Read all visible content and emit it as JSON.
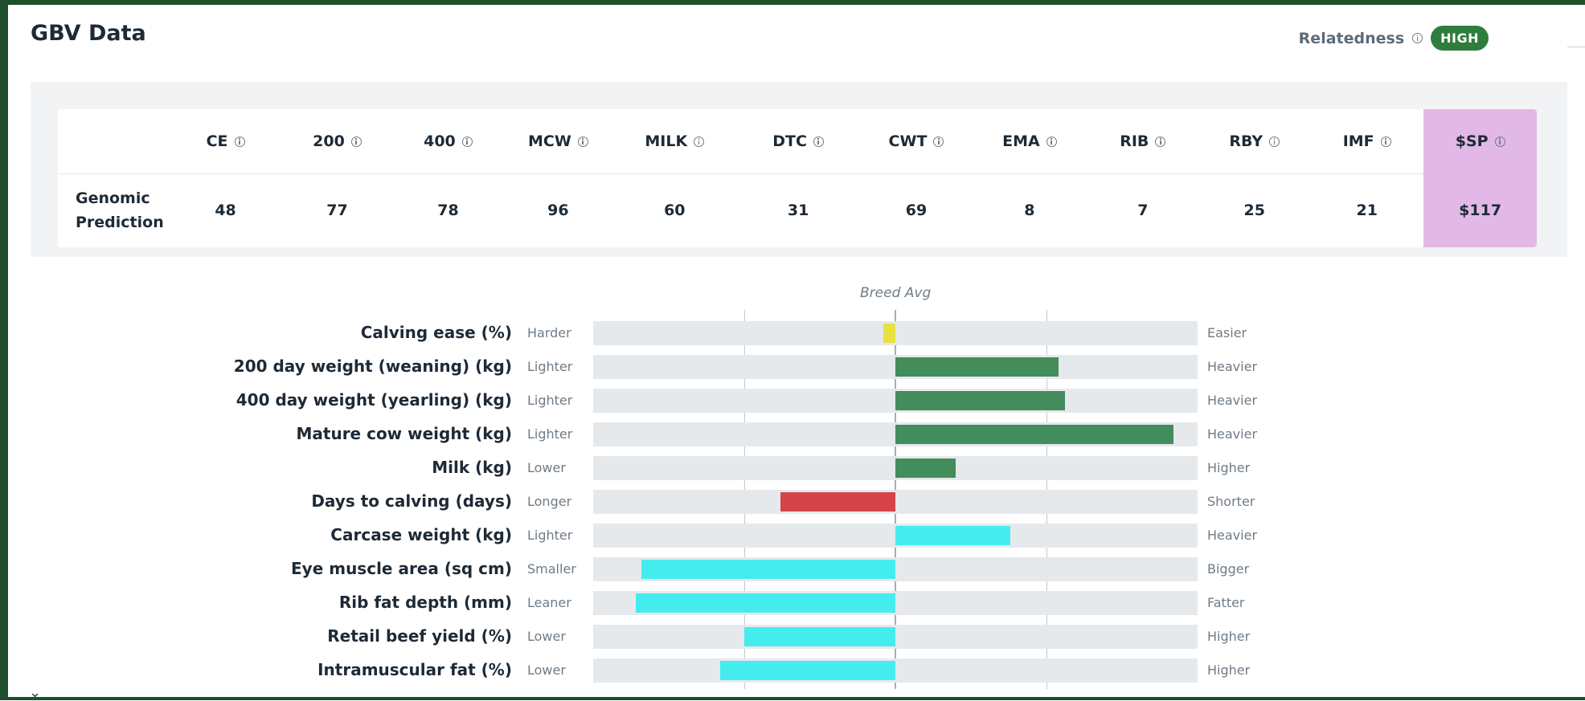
{
  "header": {
    "title": "GBV Data",
    "relatedness_label": "Relatedness",
    "relatedness_value": "HIGH"
  },
  "colors": {
    "frame": "#1f4e2c",
    "badge": "#2e7d3e",
    "sp_highlight": "#e2b9e6",
    "positive": "#438c5c",
    "negative": "#d44448",
    "cyan": "#45ecee",
    "yellow": "#e8e13f"
  },
  "gbv_table": {
    "row_label": "Genomic Prediction",
    "columns": [
      {
        "label": "CE",
        "value": "48"
      },
      {
        "label": "200",
        "value": "77"
      },
      {
        "label": "400",
        "value": "78"
      },
      {
        "label": "MCW",
        "value": "96"
      },
      {
        "label": "MILK",
        "value": "60"
      },
      {
        "label": "DTC",
        "value": "31"
      },
      {
        "label": "CWT",
        "value": "69"
      },
      {
        "label": "EMA",
        "value": "8"
      },
      {
        "label": "RIB",
        "value": "7"
      },
      {
        "label": "RBY",
        "value": "25"
      },
      {
        "label": "IMF",
        "value": "21"
      },
      {
        "label": "$SP",
        "value": "$117",
        "highlight": true
      }
    ]
  },
  "chart_data": {
    "type": "bar",
    "title": "Breed Avg",
    "center": 0,
    "xlim": [
      -1,
      1
    ],
    "series": [
      {
        "trait": "Calving ease (%)",
        "low": "Harder",
        "high": "Easier",
        "value": -0.04,
        "color": "yellow"
      },
      {
        "trait": "200 day weight (weaning) (kg)",
        "low": "Lighter",
        "high": "Heavier",
        "value": 0.54,
        "color": "positive"
      },
      {
        "trait": "400 day weight (yearling) (kg)",
        "low": "Lighter",
        "high": "Heavier",
        "value": 0.56,
        "color": "positive"
      },
      {
        "trait": "Mature cow weight (kg)",
        "low": "Lighter",
        "high": "Heavier",
        "value": 0.92,
        "color": "positive"
      },
      {
        "trait": "Milk (kg)",
        "low": "Lower",
        "high": "Higher",
        "value": 0.2,
        "color": "positive"
      },
      {
        "trait": "Days to calving (days)",
        "low": "Longer",
        "high": "Shorter",
        "value": -0.38,
        "color": "negative"
      },
      {
        "trait": "Carcase weight (kg)",
        "low": "Lighter",
        "high": "Heavier",
        "value": 0.38,
        "color": "cyan"
      },
      {
        "trait": "Eye muscle area (sq cm)",
        "low": "Smaller",
        "high": "Bigger",
        "value": -0.84,
        "color": "cyan"
      },
      {
        "trait": "Rib fat depth (mm)",
        "low": "Leaner",
        "high": "Fatter",
        "value": -0.86,
        "color": "cyan"
      },
      {
        "trait": "Retail beef yield (%)",
        "low": "Lower",
        "high": "Higher",
        "value": -0.5,
        "color": "cyan"
      },
      {
        "trait": "Intramuscular fat (%)",
        "low": "Lower",
        "high": "Higher",
        "value": -0.58,
        "color": "cyan"
      }
    ]
  }
}
